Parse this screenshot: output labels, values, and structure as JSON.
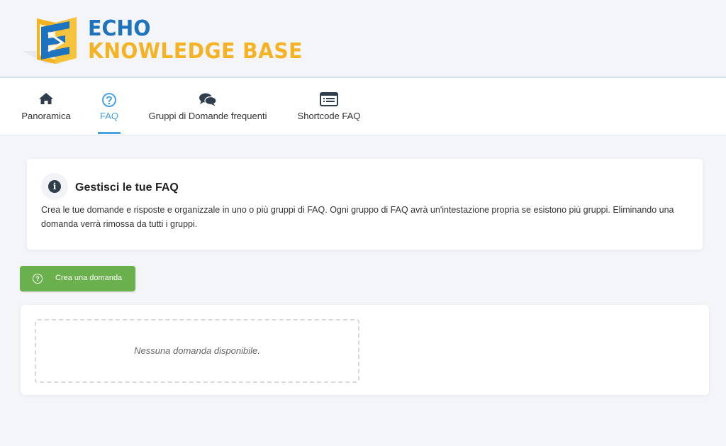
{
  "brand": {
    "line1": "ECHO",
    "line2": "KNOWLEDGE BASE",
    "colors": {
      "blue": "#1e73be",
      "gold": "#f5b324"
    }
  },
  "nav": {
    "tabs": [
      {
        "label": "Panoramica",
        "icon": "home-icon",
        "active": false
      },
      {
        "label": "FAQ",
        "icon": "question-circle-icon",
        "active": true
      },
      {
        "label": "Gruppi di Domande frequenti",
        "icon": "comments-icon",
        "active": false
      },
      {
        "label": "Shortcode FAQ",
        "icon": "list-window-icon",
        "active": false
      }
    ],
    "active_color": "#4aa3df"
  },
  "info": {
    "icon": "info-icon",
    "title": "Gestisci le tue FAQ",
    "description": "Crea le tue domande e risposte e organizzale in uno o più gruppi di FAQ. Ogni gruppo di FAQ avrà un'intestazione propria se esistono più gruppi. Eliminando una domanda verrà rimossa da tutti i gruppi."
  },
  "actions": {
    "create_label": "Crea una domanda",
    "create_icon": "question-circle-icon",
    "button_color": "#6ab04c"
  },
  "questions": {
    "empty_message": "Nessuna domanda disponibile."
  }
}
